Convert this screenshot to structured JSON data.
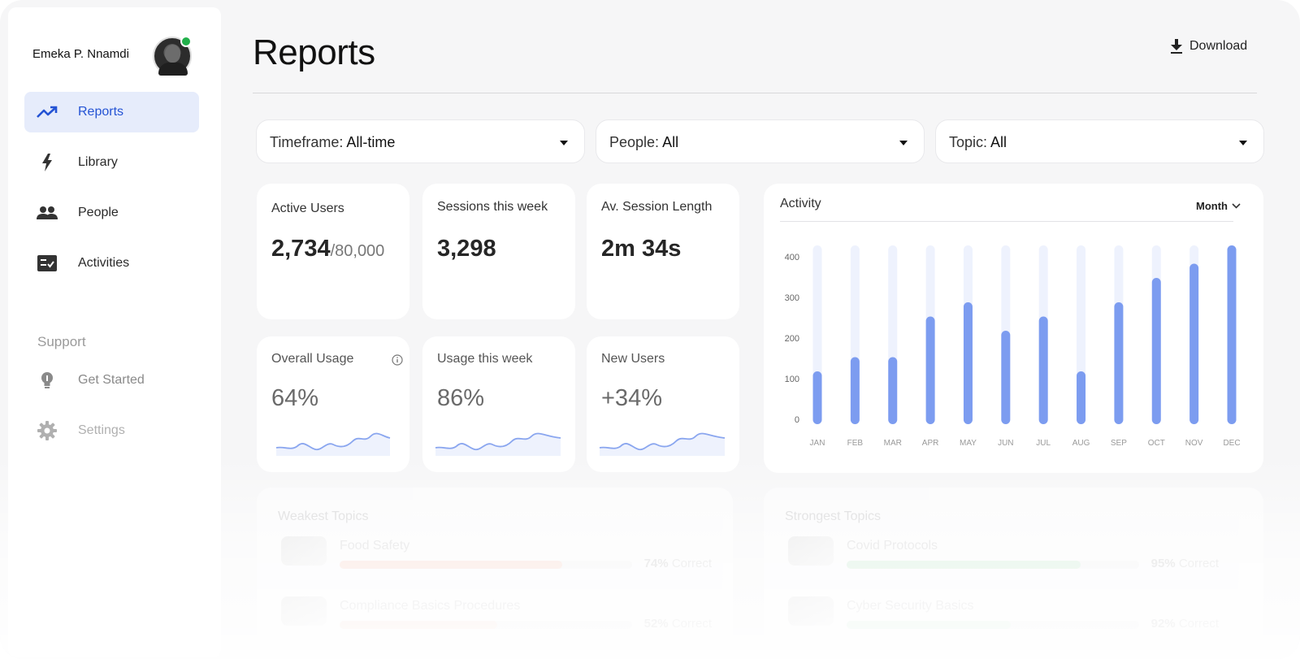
{
  "user": {
    "name": "Emeka P. Nnamdi",
    "online": true
  },
  "sidebar": {
    "items": [
      {
        "label": "Reports",
        "icon": "trending-up-icon",
        "active": true
      },
      {
        "label": "Library",
        "icon": "lightning-icon",
        "active": false
      },
      {
        "label": "People",
        "icon": "people-icon",
        "active": false
      },
      {
        "label": "Activities",
        "icon": "checklist-icon",
        "active": false
      }
    ],
    "support_title": "Support",
    "support_items": [
      {
        "label": "Get Started",
        "icon": "lightbulb-icon"
      },
      {
        "label": "Settings",
        "icon": "gear-icon"
      }
    ]
  },
  "header": {
    "title": "Reports",
    "download_label": "Download"
  },
  "filters": [
    {
      "label": "Timeframe: ",
      "value": "All-time"
    },
    {
      "label": "People: ",
      "value": "All"
    },
    {
      "label": "Topic: ",
      "value": "All"
    }
  ],
  "stats": {
    "active_users": {
      "title": "Active Users",
      "value": "2,734",
      "total": "/80,000"
    },
    "sessions": {
      "title": "Sessions this week",
      "value": "3,298"
    },
    "session_length": {
      "title": "Av. Session Length",
      "value": "2m 34s"
    },
    "overall_usage": {
      "title": "Overall Usage",
      "value": "64%"
    },
    "usage_week": {
      "title": "Usage this week",
      "value": "86%"
    },
    "new_users": {
      "title": "New Users",
      "value": "+34%"
    }
  },
  "activity": {
    "title": "Activity",
    "period_label": "Month"
  },
  "chart_data": {
    "type": "bar",
    "categories": [
      "JAN",
      "FEB",
      "MAR",
      "APR",
      "MAY",
      "JUN",
      "JUL",
      "AUG",
      "SEP",
      "OCT",
      "NOV",
      "DEC"
    ],
    "values": [
      130,
      165,
      165,
      265,
      300,
      230,
      265,
      130,
      300,
      360,
      395,
      440
    ],
    "ylim": [
      0,
      440
    ],
    "yticks": [
      0,
      100,
      200,
      300,
      400
    ],
    "background_bars": true,
    "colors": {
      "bar": "#7c9cf0",
      "bar_bg": "#eef2fd"
    }
  },
  "weakest": {
    "title": "Weakest Topics",
    "topics": [
      {
        "name": "Food Safety",
        "pct": "74%",
        "suffix": " Correct",
        "fill": 0.76,
        "color": "#f9c6b4"
      },
      {
        "name": "Compliance Basics Procedures",
        "pct": "52%",
        "suffix": " Correct",
        "fill": 0.54,
        "color": "#f9d5c8"
      }
    ]
  },
  "strongest": {
    "title": "Strongest Topics",
    "topics": [
      {
        "name": "Covid Protocols",
        "pct": "95%",
        "suffix": " Correct",
        "fill": 0.8,
        "color": "#b5e6c2"
      },
      {
        "name": "Cyber Security Basics",
        "pct": "92%",
        "suffix": " Correct",
        "fill": 0.56,
        "color": "#c7edd1"
      }
    ]
  }
}
